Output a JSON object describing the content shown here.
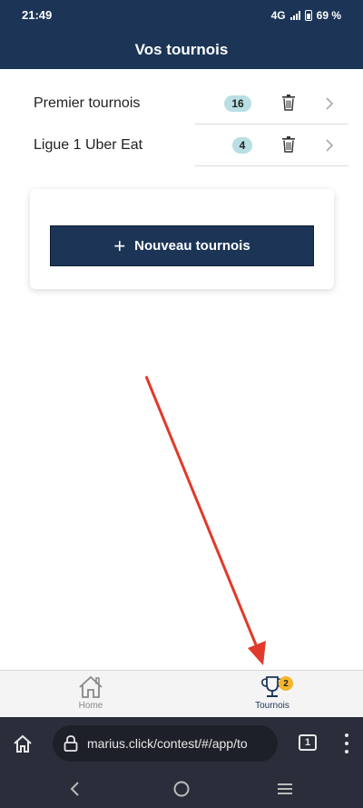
{
  "status_bar": {
    "time": "21:49",
    "network": "4G",
    "battery": "69 %"
  },
  "header": {
    "title": "Vos tournois"
  },
  "tournaments": [
    {
      "name": "Premier tournois",
      "count": "16"
    },
    {
      "name": "Ligue 1 Uber Eat",
      "count": "4"
    }
  ],
  "new_button": {
    "label": "Nouveau tournois"
  },
  "tab_bar": {
    "home_label": "Home",
    "tournois_label": "Tournois",
    "tournois_badge": "2",
    "active": "Tournois"
  },
  "browser": {
    "url": "marius.click/contest/#/app/to",
    "tab_count": "1"
  },
  "colors": {
    "primary": "#1c3557",
    "badge": "#b9dfe2",
    "notification": "#f7b52c",
    "annotation_arrow": "#e03a2a"
  },
  "icons": [
    "home-icon",
    "trophy-icon",
    "trash-icon",
    "chevron-right-icon",
    "lock-icon",
    "plus-icon"
  ]
}
